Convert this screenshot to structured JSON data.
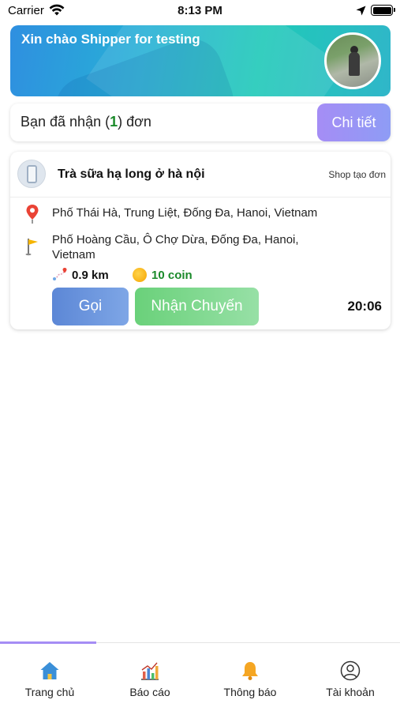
{
  "status_bar": {
    "carrier": "Carrier",
    "time": "8:13 PM"
  },
  "banner": {
    "greeting": "Xin chào Shipper for testing"
  },
  "orders_summary": {
    "prefix": "Bạn đã nhận (",
    "count": "1",
    "suffix": ") đơn",
    "detail_label": "Chi tiết"
  },
  "order": {
    "shop_name": "Trà sữa hạ long ở hà nội",
    "created_by": "Shop tạo đơn",
    "pickup_address": "Phố Thái Hà, Trung Liệt, Đống Đa, Hanoi, Vietnam",
    "dropoff_address": "Phố Hoàng Cầu, Ô Chợ Dừa, Đống Đa, Hanoi, Vietnam",
    "distance": "0.9 km",
    "coin": "10 coin",
    "call_label": "Gọi",
    "accept_label": "Nhận Chuyến",
    "time": "20:06"
  },
  "tabs": [
    {
      "label": "Trang chủ",
      "icon": "home-icon",
      "active": true
    },
    {
      "label": "Báo cáo",
      "icon": "chart-icon",
      "active": false
    },
    {
      "label": "Thông báo",
      "icon": "bell-icon",
      "active": false
    },
    {
      "label": "Tài khoản",
      "icon": "account-icon",
      "active": false
    }
  ],
  "colors": {
    "accent": "#a58df5",
    "coin_green": "#1a8a2a",
    "call_blue": "#5c87d6",
    "accept_green": "#6ad17a"
  }
}
